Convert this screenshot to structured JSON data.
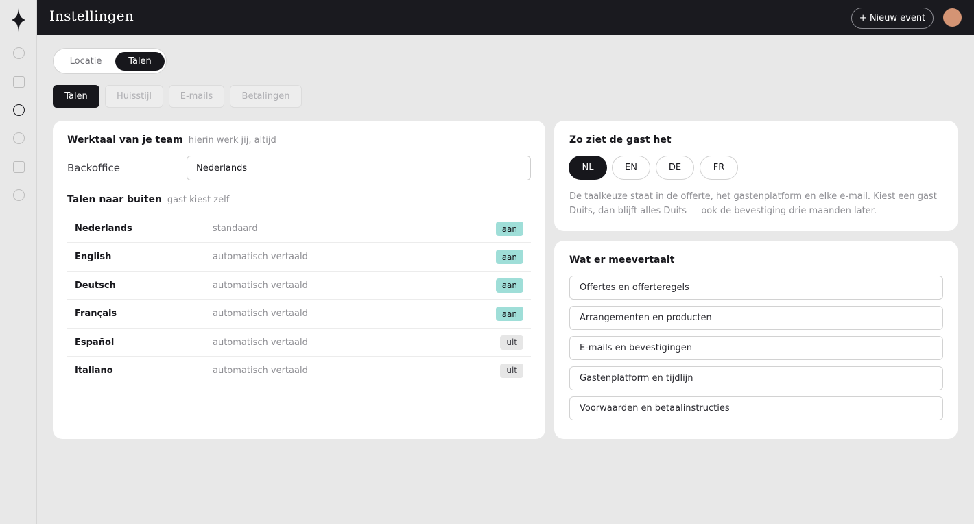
{
  "header": {
    "title": "Instellingen",
    "new_event_label": "+ Nieuw event"
  },
  "sidebar": {
    "icons": [
      "logo-diamond-icon",
      "circle-icon",
      "square-icon",
      "circle-icon",
      "circle-icon",
      "square-icon",
      "circle-icon"
    ],
    "active_index": 2
  },
  "segment": {
    "options": [
      "Locatie",
      "Talen"
    ],
    "selected": "Talen"
  },
  "tabs": [
    {
      "label": "Talen",
      "state": "active"
    },
    {
      "label": "Huisstijl",
      "state": "disabled"
    },
    {
      "label": "E-mails",
      "state": "disabled"
    },
    {
      "label": "Betalingen",
      "state": "disabled"
    }
  ],
  "work_language": {
    "title": "Werktaal van je team",
    "subtitle": "hierin werk jij, altijd",
    "backoffice_label": "Backoffice",
    "backoffice_value": "Nederlands"
  },
  "outbound_languages": {
    "title": "Talen naar buiten",
    "subtitle": "gast kiest zelf",
    "rows": [
      {
        "name": "Nederlands",
        "status": "standaard",
        "toggle": "aan"
      },
      {
        "name": "English",
        "status": "automatisch vertaald",
        "toggle": "aan"
      },
      {
        "name": "Deutsch",
        "status": "automatisch vertaald",
        "toggle": "aan"
      },
      {
        "name": "Français",
        "status": "automatisch vertaald",
        "toggle": "aan"
      },
      {
        "name": "Español",
        "status": "automatisch vertaald",
        "toggle": "uit"
      },
      {
        "name": "Italiano",
        "status": "automatisch vertaald",
        "toggle": "uit"
      }
    ]
  },
  "guest_view": {
    "title": "Zo ziet de gast het",
    "languages": [
      "NL",
      "EN",
      "DE",
      "FR"
    ],
    "selected": "NL",
    "description": "De taalkeuze staat in de offerte, het gastenplatform en elke e-mail. Kiest een gast Duits, dan blijft alles Duits — ook de bevestiging drie maanden later."
  },
  "translated": {
    "title": "Wat er meevertaalt",
    "items": [
      "Offertes en offerteregels",
      "Arrangementen en producten",
      "E-mails en bevestigingen",
      "Gastenplatform en tijdlijn",
      "Voorwaarden en betaalinstructies"
    ]
  },
  "colors": {
    "header_bg": "#1a1a1f",
    "accent_dark": "#17171c",
    "badge_on": "#9fded8",
    "badge_off": "#e6e6e6",
    "avatar": "#d49474",
    "page_bg": "#e8e8e8"
  }
}
